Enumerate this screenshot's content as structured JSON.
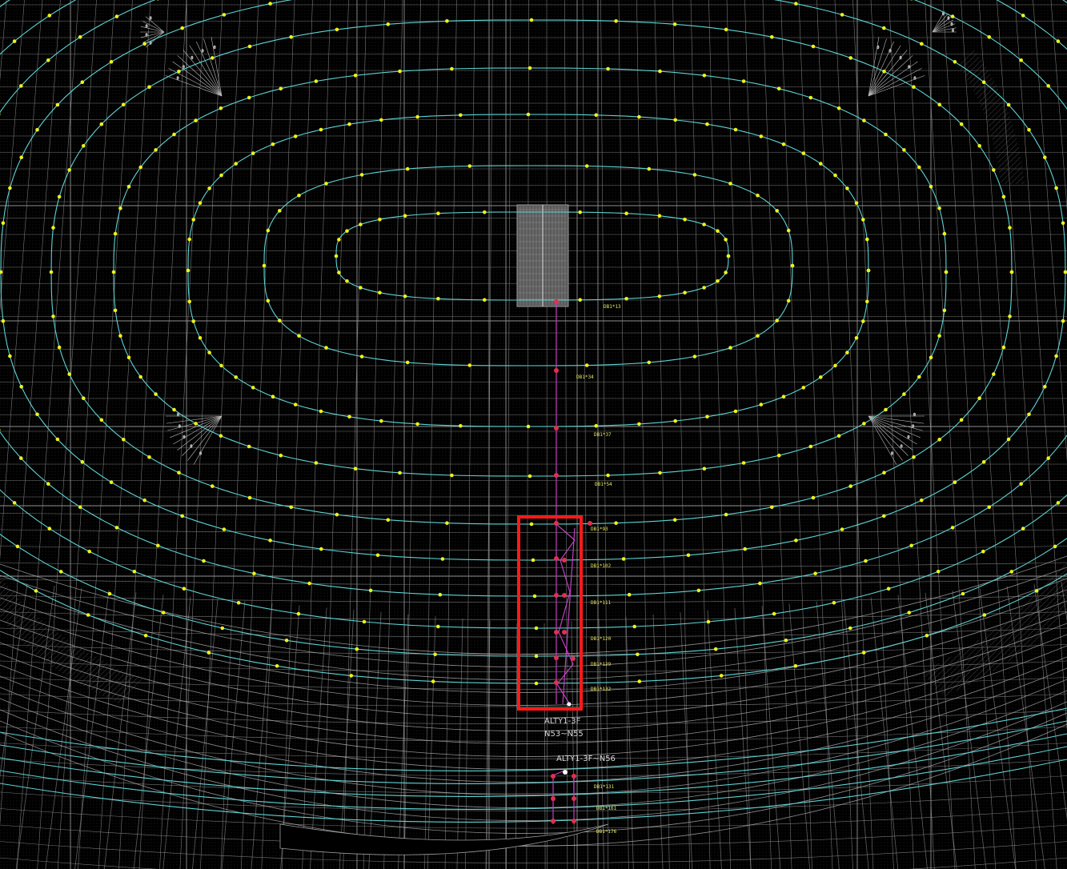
{
  "drawing": {
    "labels": {
      "tag_1_line1": "ALTY1-3F",
      "tag_1_line2": "N53~N55",
      "tag_2": "ALTY1-3F~N56",
      "rows": [
        "DB1*13",
        "DB1*34",
        "DB1*37",
        "DB1*54",
        "DB1*93",
        "DB1*102",
        "DB1*111",
        "DB1*120",
        "DB1*129",
        "DB1*132",
        "DB1*131",
        "DB1*161",
        "DB1*176"
      ]
    },
    "colors": {
      "background": "#000000",
      "grid": "#8a8a8a",
      "contour": "#5fd3d3",
      "node": "#f2f21a",
      "route": "#c040c0",
      "route_node": "#e03050",
      "highlight": "#ff1a1a",
      "label": "#e8e860",
      "tag": "#d8d8d8"
    }
  }
}
